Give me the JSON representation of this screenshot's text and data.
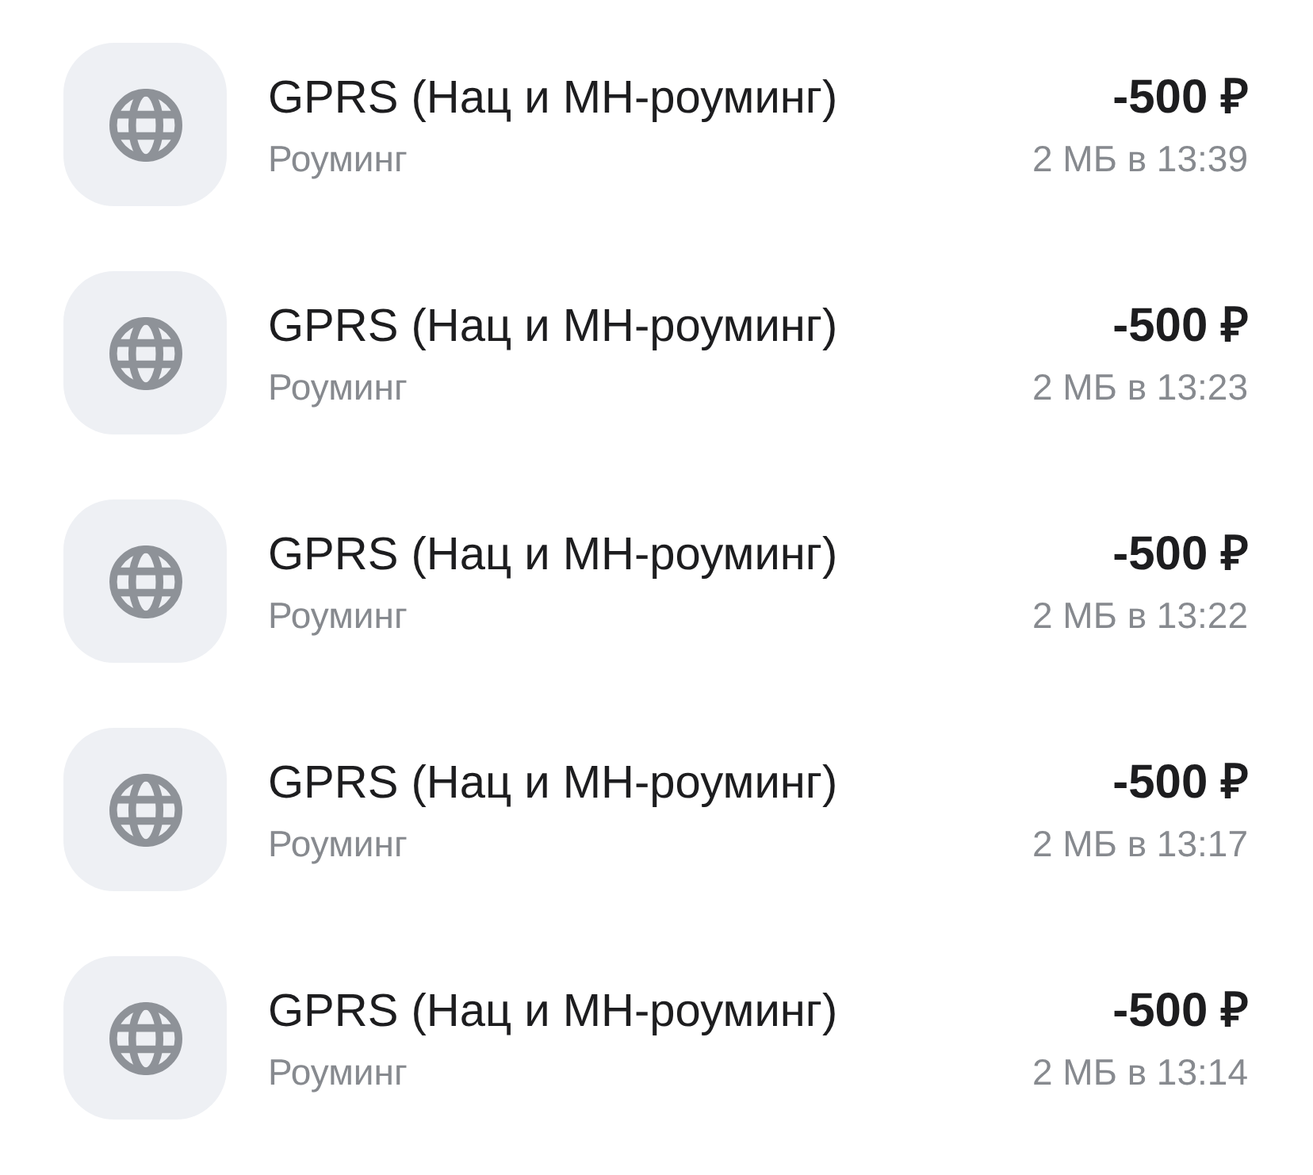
{
  "transactions": [
    {
      "title": "GPRS (Нац и МН-роуминг)",
      "category": "Роуминг",
      "amount": "-500 ₽",
      "detail": "2 МБ в 13:39"
    },
    {
      "title": "GPRS (Нац и МН-роуминг)",
      "category": "Роуминг",
      "amount": "-500 ₽",
      "detail": "2 МБ в 13:23"
    },
    {
      "title": "GPRS (Нац и МН-роуминг)",
      "category": "Роуминг",
      "amount": "-500 ₽",
      "detail": "2 МБ в 13:22"
    },
    {
      "title": "GPRS (Нац и МН-роуминг)",
      "category": "Роуминг",
      "amount": "-500 ₽",
      "detail": "2 МБ в 13:17"
    },
    {
      "title": "GPRS (Нац и МН-роуминг)",
      "category": "Роуминг",
      "amount": "-500 ₽",
      "detail": "2 МБ в 13:14"
    }
  ]
}
